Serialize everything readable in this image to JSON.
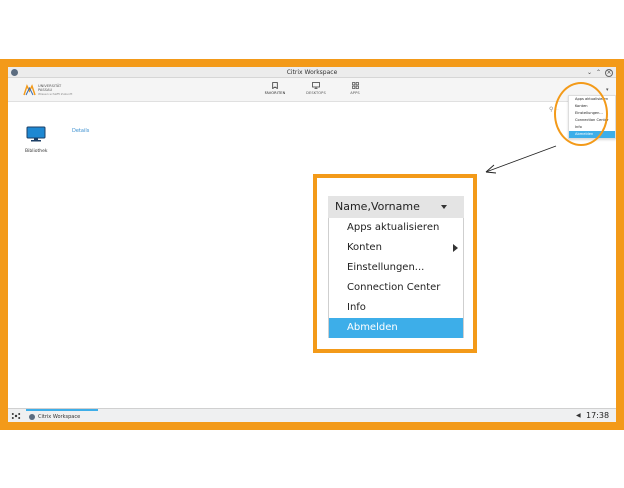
{
  "window": {
    "title": "Citrix Workspace"
  },
  "logo": {
    "line1": "UNIVERSITÄT",
    "line2": "PASSAU",
    "tagline": "Wissen schafft Zukunft"
  },
  "nav": {
    "tabs": [
      {
        "label": "FAVORITEN",
        "icon": "bookmark-icon",
        "active": true
      },
      {
        "label": "DESKTOPS",
        "icon": "monitor-icon",
        "active": false
      },
      {
        "label": "APPS",
        "icon": "grid-icon",
        "active": false
      }
    ]
  },
  "content": {
    "items": [
      {
        "label": "Bibliothek",
        "icon": "monitor-icon"
      }
    ],
    "details_link": "Details"
  },
  "user_menu": {
    "username": "Name,Vorname",
    "items": [
      {
        "label": "Apps aktualisieren",
        "active": false,
        "has_submenu": false
      },
      {
        "label": "Konten",
        "active": false,
        "has_submenu": true
      },
      {
        "label": "Einstellungen...",
        "active": false,
        "has_submenu": false
      },
      {
        "label": "Connection Center",
        "active": false,
        "has_submenu": false
      },
      {
        "label": "Info",
        "active": false,
        "has_submenu": false
      },
      {
        "label": "Abmelden",
        "active": true,
        "has_submenu": false
      }
    ]
  },
  "taskbar": {
    "task_label": "Citrix Workspace",
    "clock": "17:38"
  },
  "colors": {
    "highlight_orange": "#f39a19",
    "selection_blue": "#3daee9",
    "link_blue": "#3a8fd0"
  }
}
